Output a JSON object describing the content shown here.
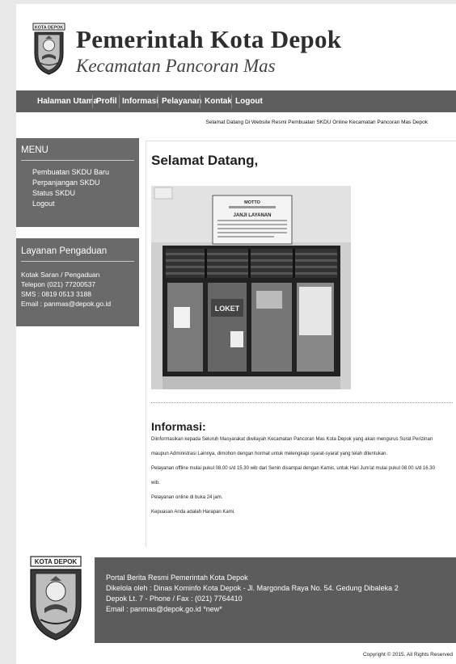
{
  "header": {
    "title": "Pemerintah Kota Depok",
    "subtitle": "Kecamatan Pancoran Mas",
    "logo_text": "KOTA DEPOK"
  },
  "nav": {
    "items": [
      "Halaman Utama",
      "Profil",
      "Informasi",
      "Pelayanan",
      "Kontak",
      "Logout"
    ]
  },
  "marquee": "Selamat Datang Di Website Resmi Pembuatan SKDU Online Kecamatan Pancoran Mas Depok",
  "sidebar": {
    "menu_title": "MENU",
    "menu_items": [
      "Pembuatan SKDU Baru",
      "Perpanjangan SKDU",
      "Status SKDU",
      "Logout"
    ],
    "service_title": "Layanan Pengaduan",
    "service_lines": [
      "Kotak Saran / Pengaduan",
      "Telepon (021) 77200537",
      "SMS : 0819 0513 3188",
      "Email : panmas@depok.go.id"
    ]
  },
  "content": {
    "welcome": "Selamat Datang,",
    "photo_sign": {
      "motto": "MOTTO",
      "janji": "JANJI LAYANAN",
      "loket": "LOKET"
    },
    "info_title": "Informasi:",
    "info_lines": [
      "Diinformasikan kepada Seluruh Masyarakat diwilayah Kecamatan Pancoran Mas Kota Depok yang akan mengurus Surat Perizinan",
      "maupun Administrasi Lainnya, dimohon dengan hormat untuk melengkapi syarat-syarat yang telah ditentukan.",
      "Pelayanan offline mulai pukul 08.00 s/d 15.30 wib dari Senin disampai dengan Kamis, untuk Hari Jum'at mulai pukul 08.00 s/d 16.30",
      "wib.",
      "Pelayanan online di buka 24 jam.",
      "Kepuasan Anda adalah Harapan Kami."
    ]
  },
  "footer": {
    "logo_text": "KOTA DEPOK",
    "lines": [
      "Portal Berita Resmi Pemerintah Kota Depok",
      "Dikelola oleh : Dinas Kominfo Kota Depok - Jl. Margonda Raya No. 54. Gedung Dibaleka 2",
      "Depok Lt. 7 - Phone / Fax : (021) 7764410",
      "Email : panmas@depok.go.id *new*"
    ],
    "copyright": "Copyright © 2015. All Rights Reserved"
  }
}
